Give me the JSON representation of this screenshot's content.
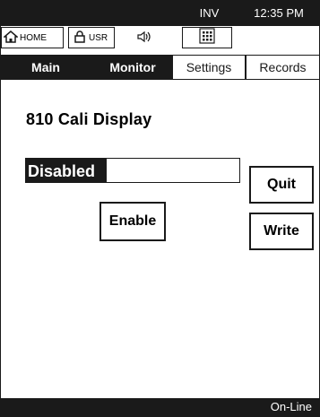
{
  "topbar": {
    "home_label": "HOME",
    "user_label": "USR",
    "inventory_label": "INV",
    "time": "12:35 PM"
  },
  "tabs": [
    "Main",
    "Monitor",
    "Settings",
    "Records"
  ],
  "page": {
    "title": "810  Cali Display",
    "status_value": "Disabled",
    "enable_button": "Enable",
    "quit_button": "Quit",
    "write_button": "Write"
  },
  "footer": {
    "status": "On-Line"
  }
}
